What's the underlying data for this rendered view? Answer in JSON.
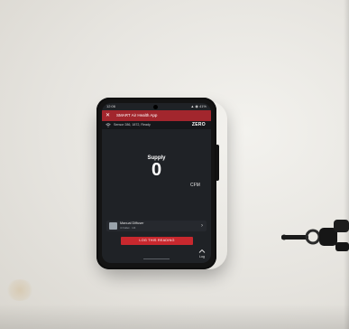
{
  "status_bar": {
    "time": "12:06",
    "right": "▲ ◉ 41%"
  },
  "app": {
    "title": "SMART Air Health App",
    "close_glyph": "✕",
    "device_line": "Sensor 286, 1872, Ready",
    "brand": "ZERO"
  },
  "reading": {
    "label": "Supply",
    "value": "0",
    "unit": "CFM"
  },
  "diffuser": {
    "title": "Manual Diffuser",
    "subtitle": "4 Outlet · 1/4",
    "chevron": "›"
  },
  "actions": {
    "log_reading": "LOG THIS READING",
    "log_tab": "Log"
  },
  "icons": {
    "close": "close-icon",
    "wifi": "wifi-icon",
    "chevron": "chevron-right-icon",
    "log": "log-icon"
  },
  "colors": {
    "accent_red": "#c8282e",
    "appbar_red": "#a2262d",
    "screen_bg": "#1f2226",
    "table_surface": "#e9e7e2"
  }
}
